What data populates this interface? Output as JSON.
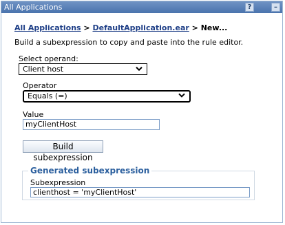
{
  "window": {
    "title": "All Applications",
    "help_label": "?",
    "minimize_label": "–"
  },
  "breadcrumb": {
    "link1": "All Applications",
    "sep1": " > ",
    "link2": "DefaultApplication.ear",
    "sep2": " > ",
    "current": "New..."
  },
  "description": "Build a subexpression to copy and paste into the rule editor.",
  "operand": {
    "label": "Select operand:",
    "value": "Client host"
  },
  "operator": {
    "label": "Operator",
    "value": "Equals (=)"
  },
  "value_field": {
    "label": "Value",
    "value": "myClientHost"
  },
  "build_button": "Build subexpression",
  "generated": {
    "legend": "Generated subexpression",
    "label": "Subexpression",
    "value": "clienthost = 'myClientHost'"
  },
  "colors": {
    "title_bar": "#4a73ad",
    "legend_text": "#2b5f9e",
    "link": "#1f3f87"
  },
  "icons": {
    "dropdown": "chevron-down-icon",
    "help": "help-icon",
    "minimize": "minimize-icon"
  }
}
